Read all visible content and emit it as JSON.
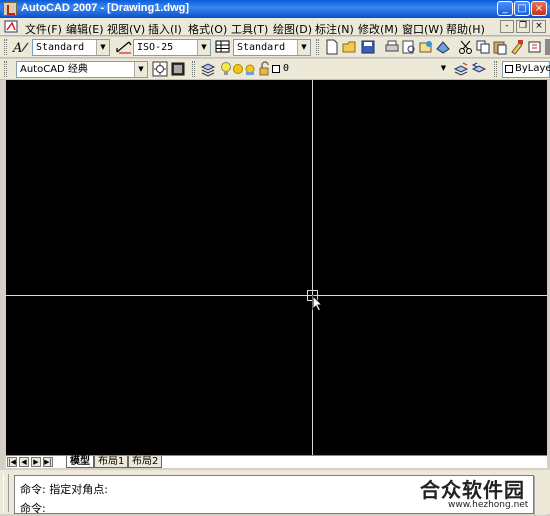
{
  "window": {
    "title": "AutoCAD 2007 - [Drawing1.dwg]",
    "controls": {
      "minimize": "_",
      "maximize": "□",
      "close": "×"
    }
  },
  "menubar": {
    "items": [
      "文件(F)",
      "编辑(E)",
      "视图(V)",
      "插入(I)",
      "格式(O)",
      "工具(T)",
      "绘图(D)",
      "标注(N)",
      "修改(M)",
      "窗口(W)",
      "帮助(H)"
    ],
    "doc_controls": {
      "minimize": "-",
      "restore": "❐",
      "close": "×"
    }
  },
  "styles_toolbar": {
    "text_style": "Standard",
    "dim_style": "ISO-25",
    "table_style": "Standard"
  },
  "workspace_toolbar": {
    "workspace": "AutoCAD 经典",
    "layer": "0",
    "color": "ByLayer"
  },
  "layout_tabs": [
    "模型",
    "布局1",
    "布局2"
  ],
  "active_tab": "模型",
  "command": {
    "line1": "命令: 指定对角点:",
    "line2": "命令:"
  },
  "watermark": {
    "title": "合众软件园",
    "url": "www.hezhong.net"
  },
  "colors": {
    "title_bar": "#0a5bd8",
    "drawing_bg": "#000000",
    "crosshair": "#d8d8d8",
    "chrome": "#ece9d8"
  }
}
